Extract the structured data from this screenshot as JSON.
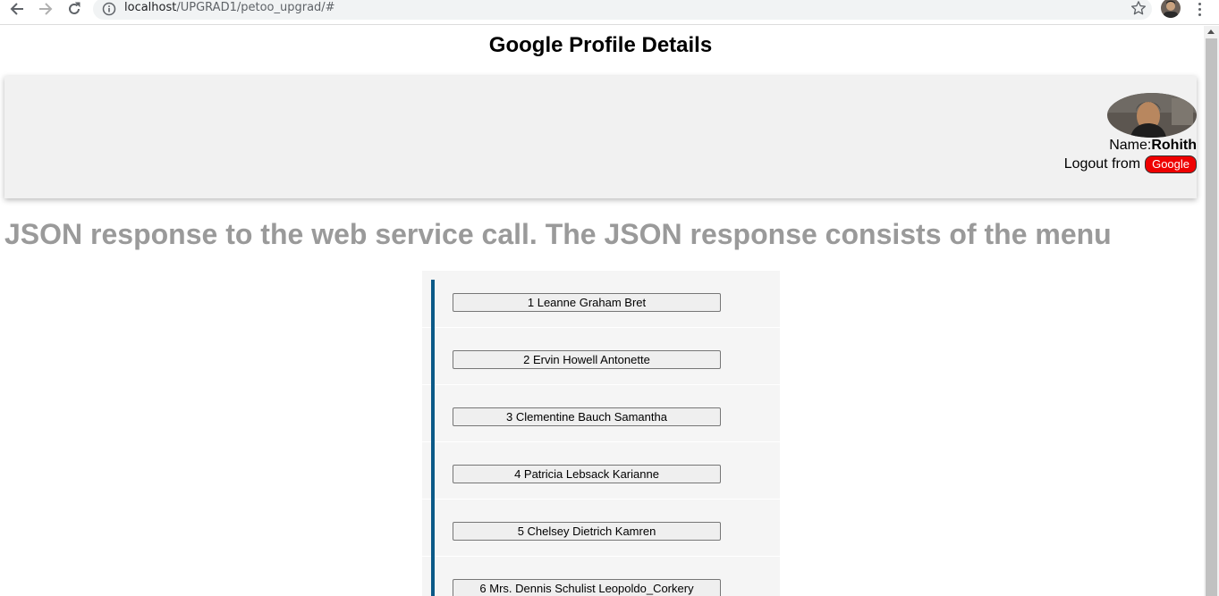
{
  "browser": {
    "url_host": "localhost",
    "url_path": "/UPGRAD1/petoo_upgrad/#"
  },
  "page": {
    "title": "Google Profile Details"
  },
  "profile": {
    "name_label": "Name:",
    "name_value": "Rohith",
    "logout_label": "Logout from",
    "logout_button": "Google"
  },
  "heading": "JSON response to the web service call. The JSON response consists of the menu",
  "users": [
    {
      "label": "1 Leanne Graham Bret"
    },
    {
      "label": "2 Ervin Howell Antonette"
    },
    {
      "label": "3 Clementine Bauch Samantha"
    },
    {
      "label": "4 Patricia Lebsack Karianne"
    },
    {
      "label": "5 Chelsey Dietrich Kamren"
    },
    {
      "label": "6 Mrs. Dennis Schulist Leopoldo_Corkery"
    }
  ],
  "colors": {
    "accent_bar": "#0b5a88",
    "logout_button_bg": "#ee0000",
    "heading_gray": "#9a9a9a"
  },
  "icons": [
    "back-arrow-icon",
    "forward-arrow-icon",
    "reload-icon",
    "info-icon",
    "star-icon",
    "kebab-menu-icon"
  ]
}
